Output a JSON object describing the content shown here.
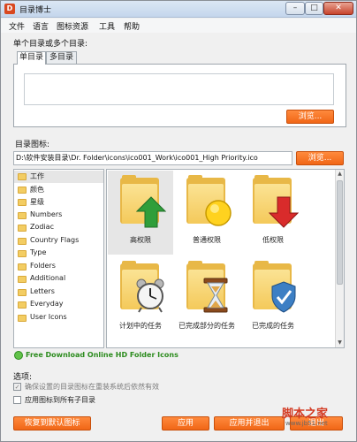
{
  "window": {
    "title": "目录博士",
    "app_icon_letter": "D",
    "min_glyph": "–",
    "max_glyph": "□",
    "close_glyph": "✕"
  },
  "menu": [
    "文件",
    "语言",
    "图标资源",
    "工具",
    "帮助"
  ],
  "directory_section": {
    "label": "单个目录或多个目录:",
    "tabs": [
      "单目录",
      "多目录"
    ],
    "active_tab": 0,
    "browse_label": "浏览..."
  },
  "icon_section": {
    "label": "目录图标:",
    "path_value": "D:\\软件安装目录\\Dr. Folder\\icons\\ico001_Work\\ico001_High Priority.ico",
    "browse_label": "浏览..."
  },
  "folder_list": [
    {
      "label": "工作",
      "selected": true
    },
    {
      "label": "颜色"
    },
    {
      "label": "星级"
    },
    {
      "label": "Numbers"
    },
    {
      "label": "Zodiac"
    },
    {
      "label": "Country Flags"
    },
    {
      "label": "Type"
    },
    {
      "label": "Folders"
    },
    {
      "label": "Additional"
    },
    {
      "label": "Letters"
    },
    {
      "label": "Everyday"
    },
    {
      "label": "User Icons"
    }
  ],
  "icons": [
    {
      "label": "高权限",
      "overlay": "up-arrow-icon",
      "selected": true
    },
    {
      "label": "普通权限",
      "overlay": "circle-icon"
    },
    {
      "label": "低权限",
      "overlay": "down-arrow-icon"
    },
    {
      "label": "计划中的任务",
      "overlay": "alarm-clock-icon"
    },
    {
      "label": "已完成部分的任务",
      "overlay": "hourglass-icon"
    },
    {
      "label": "已完成的任务",
      "overlay": "check-shield-icon"
    }
  ],
  "scroll": {
    "up": "▲",
    "down": "▼"
  },
  "download_link": "Free Download Online HD Folder Icons",
  "options": {
    "label": "选项:",
    "items": [
      {
        "label": "确保设置的目录图标在重装系统后依然有效",
        "checked": true,
        "disabled": true
      },
      {
        "label": "应用图标到所有子目录",
        "checked": false,
        "disabled": false
      }
    ],
    "check_glyph": "✓"
  },
  "buttons": {
    "restore": "恢复到默认图标",
    "apply": "应用",
    "apply_exit": "应用并退出",
    "exit": "退出"
  },
  "watermark": {
    "text": "脚本之家",
    "url": "www.jb51.net"
  }
}
